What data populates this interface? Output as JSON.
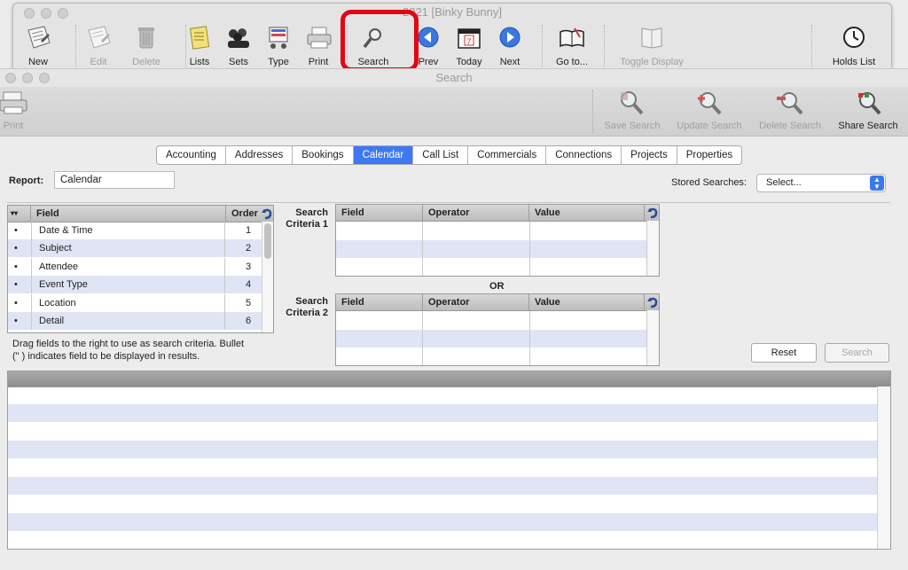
{
  "back_window": {
    "title": "2021  [Binky Bunny]",
    "toolbar": [
      {
        "id": "new",
        "label": "New",
        "icon": "new-doc-icon",
        "enabled": true
      },
      {
        "id": "edit",
        "label": "Edit",
        "icon": "edit-doc-icon",
        "enabled": false
      },
      {
        "id": "delete",
        "label": "Delete",
        "icon": "trash-icon",
        "enabled": false
      },
      {
        "id": "lists",
        "label": "Lists",
        "icon": "list-notepad-icon",
        "enabled": true
      },
      {
        "id": "sets",
        "label": "Sets",
        "icon": "people-sets-icon",
        "enabled": true
      },
      {
        "id": "type",
        "label": "Type",
        "icon": "type-cart-icon",
        "enabled": true
      },
      {
        "id": "print",
        "label": "Print",
        "icon": "printer-icon",
        "enabled": true
      },
      {
        "id": "search",
        "label": "Search",
        "icon": "magnifier-icon",
        "enabled": true
      },
      {
        "id": "prev",
        "label": "Prev",
        "icon": "arrow-left-icon",
        "enabled": true
      },
      {
        "id": "today",
        "label": "Today",
        "icon": "calendar-icon",
        "enabled": true
      },
      {
        "id": "next",
        "label": "Next",
        "icon": "arrow-right-icon",
        "enabled": true
      },
      {
        "id": "goto",
        "label": "Go to...",
        "icon": "book-icon",
        "enabled": true
      },
      {
        "id": "toggle",
        "label": "Toggle Display",
        "icon": "open-book-icon",
        "enabled": false
      },
      {
        "id": "holds",
        "label": "Holds List",
        "icon": "clock-icon",
        "enabled": true
      }
    ],
    "calendar_day": "7"
  },
  "search_window": {
    "title": "Search",
    "toolbar": {
      "print": "Print",
      "save_search": "Save Search",
      "update_search": "Update Search",
      "delete_search": "Delete Search",
      "share_search": "Share Search"
    },
    "tabs": [
      "Accounting",
      "Addresses",
      "Bookings",
      "Calendar",
      "Call List",
      "Commercials",
      "Connections",
      "Projects",
      "Properties"
    ],
    "active_tab": "Calendar",
    "report_label": "Report:",
    "report_value": "Calendar",
    "stored_searches_label": "Stored Searches:",
    "stored_searches_value": "Select...",
    "fields_table": {
      "headers": [
        "Field",
        "Order"
      ],
      "rows": [
        {
          "bullet": "•",
          "field": "Date & Time",
          "order": "1"
        },
        {
          "bullet": "•",
          "field": "Subject",
          "order": "2"
        },
        {
          "bullet": "•",
          "field": "Attendee",
          "order": "3"
        },
        {
          "bullet": "•",
          "field": "Event Type",
          "order": "4"
        },
        {
          "bullet": "•",
          "field": "Location",
          "order": "5"
        },
        {
          "bullet": "•",
          "field": "Detail",
          "order": "6"
        }
      ]
    },
    "help_text_line1": "Drag fields to the right to use as search criteria.  Bullet",
    "help_text_line2": "(\" ) indicates field to be displayed in results.",
    "criteria1_label": "Search Criteria 1",
    "criteria2_label": "Search Criteria 2",
    "criteria_headers": [
      "Field",
      "Operator",
      "Value"
    ],
    "or_label": "OR",
    "reset_button": "Reset",
    "search_button": "Search"
  }
}
